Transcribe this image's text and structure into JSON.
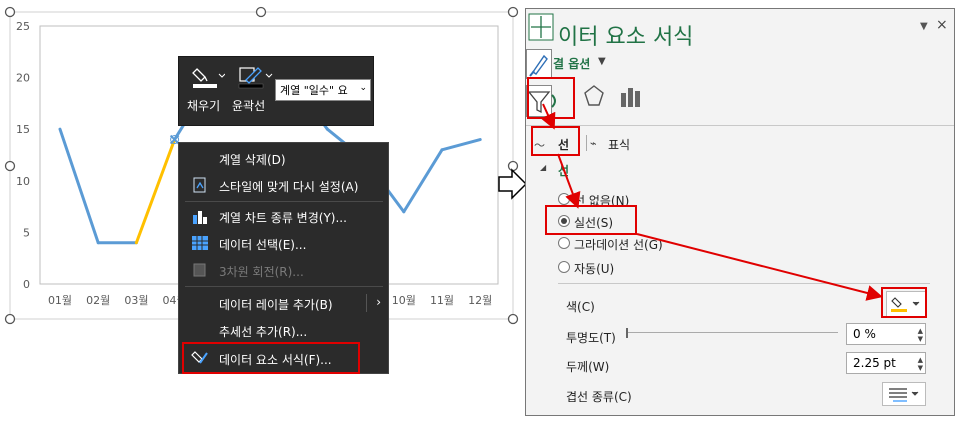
{
  "chart_data": {
    "type": "line",
    "categories": [
      "01월",
      "02월",
      "03월",
      "04월",
      "05월",
      "06월",
      "07월",
      "08월",
      "09월",
      "10월",
      "11월",
      "12월"
    ],
    "series": [
      {
        "values": [
          15,
          4,
          4,
          14,
          20,
          20,
          20,
          15,
          12,
          7,
          13,
          14
        ]
      }
    ],
    "highlight_segment": [
      2,
      3
    ],
    "ylim": [
      0,
      25
    ],
    "yticks": [
      0,
      5,
      10,
      15,
      20,
      25
    ],
    "grid": false,
    "colors": {
      "line": "#5b9bd5",
      "highlight": "#ffc000"
    }
  },
  "mini_toolbar": {
    "fill_label": "채우기",
    "outline_label": "윤곽선",
    "series_select": "계열 \"일수\" 요"
  },
  "context_menu": {
    "items": [
      {
        "label": "계열 삭제(D)",
        "icon": "none"
      },
      {
        "label": "스타일에 맞게 다시 설정(A)",
        "icon": "reset-style-icon"
      },
      {
        "label": "계열 차트 종류 변경(Y)...",
        "icon": "chart-type-icon"
      },
      {
        "label": "데이터 선택(E)...",
        "icon": "select-data-icon"
      },
      {
        "label": "3차원 회전(R)...",
        "icon": "rotate-3d-icon",
        "disabled": true
      },
      {
        "label": "데이터 레이블 추가(B)",
        "icon": "none",
        "submenu": true
      },
      {
        "label": "추세선 추가(R)...",
        "icon": "none"
      },
      {
        "label": "데이터 요소 서식(F)...",
        "icon": "format-data-point-icon"
      }
    ]
  },
  "format_pane": {
    "title": "이터 요소 서식",
    "options_label": "결 옵션",
    "tab_line": "선",
    "tab_marker": "표식",
    "section_line": "선",
    "radio_none": "선 없음(N)",
    "radio_solid": "실선(S)",
    "radio_gradient": "그라데이션 선(G)",
    "radio_auto": "자동(U)",
    "color_label": "색(C)",
    "transparency_label": "투명도(T)",
    "transparency_value": "0 %",
    "width_label": "두께(W)",
    "width_value": "2.25 pt",
    "compound_label": "겹선 종류(C)",
    "colors": {
      "title": "#217346",
      "highlight": "#e00000",
      "fill": "#ffc000"
    }
  }
}
